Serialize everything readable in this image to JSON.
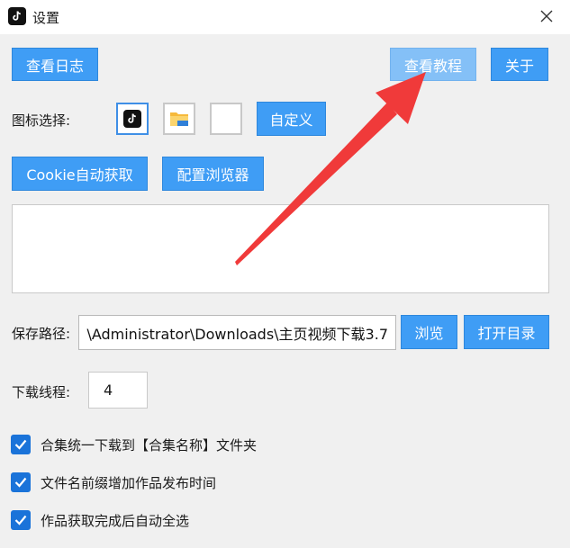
{
  "window": {
    "title": "设置",
    "close_label": "×"
  },
  "toolbar": {
    "view_log": "查看日志",
    "view_tutorial": "查看教程",
    "about": "关于"
  },
  "icon_select": {
    "label": "图标选择:",
    "options": [
      "tiktok-icon",
      "folder-icon",
      "blank"
    ],
    "custom_button": "自定义"
  },
  "cookie": {
    "auto_get_button": "Cookie自动获取",
    "config_browser_button": "配置浏览器",
    "text_value": ""
  },
  "save_path": {
    "label": "保存路径:",
    "value": "\\Administrator\\Downloads\\主页视频下载3.7",
    "browse_button": "浏览",
    "open_dir_button": "打开目录"
  },
  "threads": {
    "label": "下载线程:",
    "value": "4"
  },
  "options": [
    {
      "label": "合集统一下载到【合集名称】文件夹",
      "checked": true
    },
    {
      "label": "文件名前缀增加作品发布时间",
      "checked": true
    },
    {
      "label": "作品获取完成后自动全选",
      "checked": true
    }
  ],
  "colors": {
    "accent": "#3f9df5",
    "checkbox": "#1a73d9",
    "arrow": "#f03a3a"
  }
}
